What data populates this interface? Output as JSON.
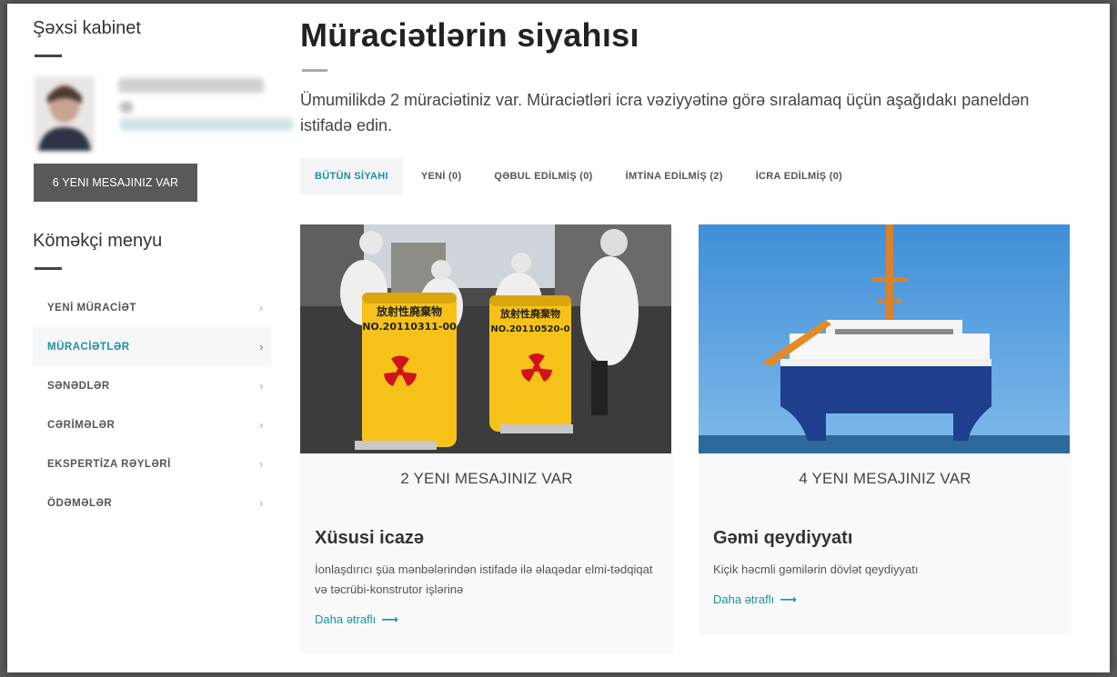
{
  "sidebar": {
    "title": "Şəxsi kabinet",
    "messages_button": "6 YENI MESAJINIZ VAR",
    "helper_title": "Köməkçi menyu",
    "menu": [
      {
        "label": "YENİ MÜRACİƏT",
        "active": false
      },
      {
        "label": "MÜRACİƏTLƏR",
        "active": true
      },
      {
        "label": "SƏNƏDLƏR",
        "active": false
      },
      {
        "label": "CƏRİMƏLƏR",
        "active": false
      },
      {
        "label": "EKSPERTİZA RƏYLƏRİ",
        "active": false
      },
      {
        "label": "ÖDƏMƏLƏR",
        "active": false
      }
    ]
  },
  "main": {
    "title": "Müraciətlərin siyahısı",
    "intro": "Ümumilikdə 2 müraciətiniz var. Müraciətləri icra vəziyyətinə görə sıralamaq üçün aşağıdakı paneldən istifadə edin.",
    "tabs": [
      {
        "label": "BÜTÜN SİYAHI"
      },
      {
        "label": "YENİ (0)"
      },
      {
        "label": "QƏBUL EDİLMİŞ (0)"
      },
      {
        "label": "İMTİNA EDİLMİŞ (2)"
      },
      {
        "label": "İCRA EDİLMİŞ (0)"
      }
    ],
    "cards": [
      {
        "messages": "2 YENI MESAJINIZ VAR",
        "title": "Xüsusi icazə",
        "description": "İonlaşdırıcı şüa mənbələrindən istifadə ilə əlaqədar elmi-tədqiqat və təcrübi-konstrutor işlərinə",
        "link": "Daha ətraflı",
        "drum_label_1": "放射性廃棄物",
        "drum_code_1": "NO.20110311-00",
        "drum_label_2": "放射性廃棄物",
        "drum_code_2": "NO.20110520-0"
      },
      {
        "messages": "4 YENI MESAJINIZ VAR",
        "title": "Gəmi qeydiyyatı",
        "description": "Kiçik həcmli gəmilərin dövlət qeydiyyatı",
        "link": "Daha ətraflı"
      }
    ]
  },
  "colors": {
    "accent": "#1f8fa3",
    "button_bg": "#595959"
  },
  "icons": {
    "chevron": "chevron-right-icon",
    "arrow": "arrow-right-icon"
  }
}
